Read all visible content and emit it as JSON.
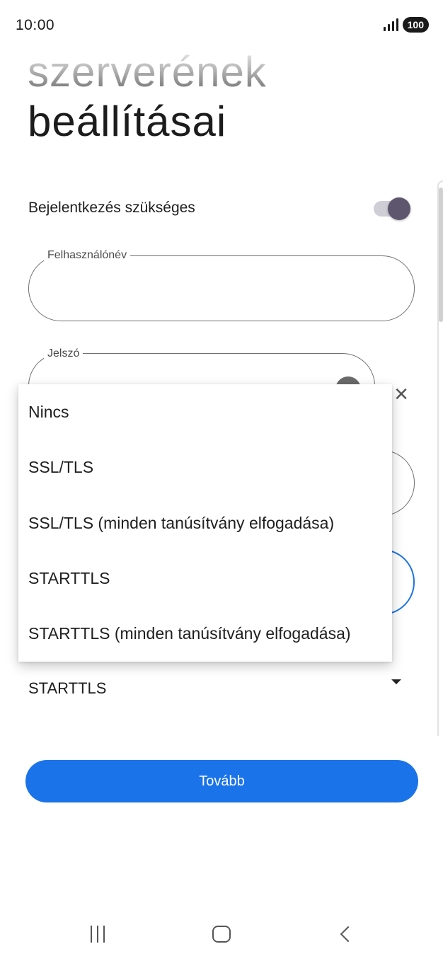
{
  "status_bar": {
    "time": "10:00",
    "battery": "100"
  },
  "header": {
    "title_line1": "szerverének",
    "title_line2": "beállításai"
  },
  "login_required": {
    "label": "Bejelentkezés szükséges",
    "enabled": true
  },
  "username": {
    "label": "Felhasználónév",
    "value": ""
  },
  "password": {
    "label": "Jelszó",
    "value": ""
  },
  "security": {
    "selected": "STARTTLS",
    "options": [
      "Nincs",
      "SSL/TLS",
      "SSL/TLS (minden tanúsítvány elfogadása)",
      "STARTTLS",
      "STARTTLS (minden tanúsítvány elfogadása)"
    ]
  },
  "next_button": {
    "label": "Tovább"
  },
  "colors": {
    "accent": "#1a73e8",
    "toggle_knob": "#5d566e",
    "toggle_track": "#cfcdd6"
  },
  "icons": {
    "signal": "signal-icon",
    "battery": "battery-icon",
    "eye": "visibility-icon",
    "close": "close-icon",
    "dropdown": "arrow-drop-down-icon",
    "nav_recent": "recent-apps-icon",
    "nav_home": "home-icon",
    "nav_back": "back-icon"
  }
}
